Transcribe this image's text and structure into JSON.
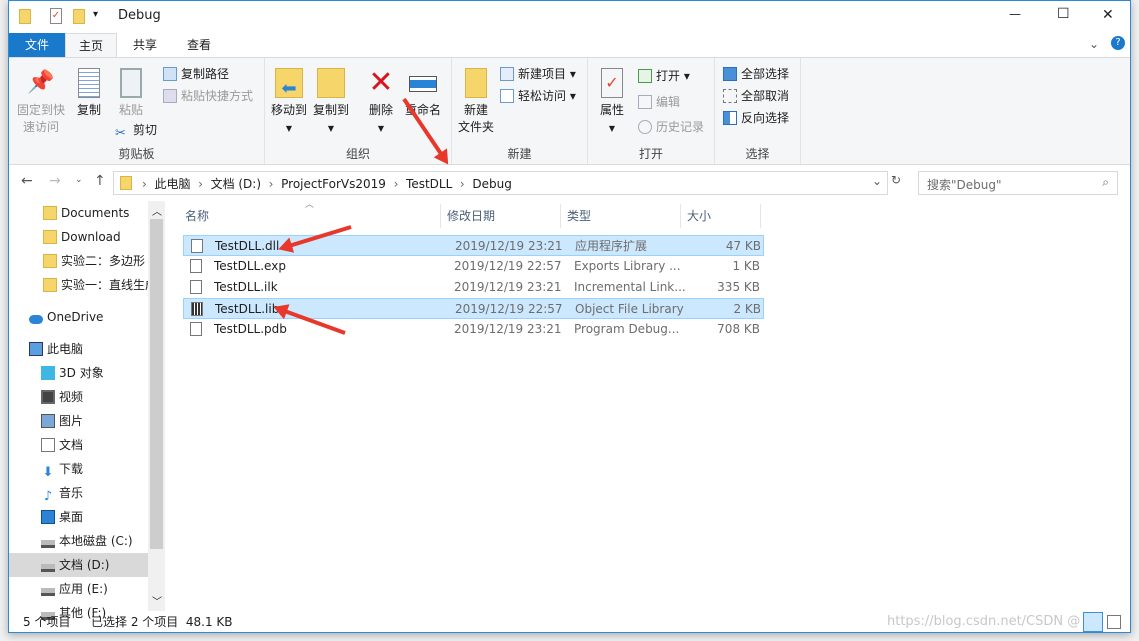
{
  "window": {
    "title": "Debug",
    "minimize": "—",
    "maximize": "☐",
    "close": "✕"
  },
  "tabs": [
    {
      "label": "文件"
    },
    {
      "label": "主页"
    },
    {
      "label": "共享"
    },
    {
      "label": "查看"
    }
  ],
  "help": "?",
  "ribbon": {
    "clipboard": {
      "label": "剪贴板",
      "pin": "固定到快\n速访问",
      "copy": "复制",
      "paste": "粘贴",
      "copy_path": "复制路径",
      "paste_shortcut": "粘贴快捷方式",
      "cut": "剪切"
    },
    "organize": {
      "label": "组织",
      "move_to": "移动到",
      "copy_to": "复制到",
      "delete": "删除",
      "rename": "重命名"
    },
    "new": {
      "label": "新建",
      "new_folder": "新建\n文件夹",
      "new_item": "新建项目",
      "easy_access": "轻松访问"
    },
    "open": {
      "label": "打开",
      "properties": "属性",
      "open": "打开",
      "edit": "编辑",
      "history": "历史记录"
    },
    "select": {
      "label": "选择",
      "select_all": "全部选择",
      "select_none": "全部取消",
      "invert": "反向选择"
    }
  },
  "address": {
    "crumbs": [
      "此电脑",
      "文档 (D:)",
      "ProjectForVs2019",
      "TestDLL",
      "Debug"
    ],
    "search_placeholder": "搜索\"Debug\""
  },
  "sidebar": {
    "items": [
      {
        "label": "Documents",
        "icon": "folder-icon"
      },
      {
        "label": "Download",
        "icon": "folder-icon"
      },
      {
        "label": "实验二：多边形",
        "icon": "folder-icon"
      },
      {
        "label": "实验一：直线生成",
        "icon": "folder-icon"
      },
      {
        "label": "OneDrive",
        "icon": "cloud-icon"
      },
      {
        "label": "此电脑",
        "icon": "computer-icon"
      },
      {
        "label": "3D 对象",
        "icon": "cube-icon"
      },
      {
        "label": "视频",
        "icon": "video-icon"
      },
      {
        "label": "图片",
        "icon": "picture-icon"
      },
      {
        "label": "文档",
        "icon": "document-icon"
      },
      {
        "label": "下载",
        "icon": "download-icon"
      },
      {
        "label": "音乐",
        "icon": "music-icon"
      },
      {
        "label": "桌面",
        "icon": "desktop-icon"
      },
      {
        "label": "本地磁盘 (C:)",
        "icon": "drive-icon"
      },
      {
        "label": "文档 (D:)",
        "icon": "drive-icon",
        "selected": true
      },
      {
        "label": "应用 (E:)",
        "icon": "drive-icon"
      },
      {
        "label": "其他 (F:)",
        "icon": "drive-icon"
      }
    ]
  },
  "columns": {
    "name": "名称",
    "date": "修改日期",
    "type": "类型",
    "size": "大小"
  },
  "files": [
    {
      "name": "TestDLL.dll",
      "date": "2019/12/19 23:21",
      "type": "应用程序扩展",
      "size": "47 KB",
      "selected": true,
      "icon": "dll-icon"
    },
    {
      "name": "TestDLL.exp",
      "date": "2019/12/19 22:57",
      "type": "Exports Library ...",
      "size": "1 KB",
      "selected": false,
      "icon": "gear-file-icon"
    },
    {
      "name": "TestDLL.ilk",
      "date": "2019/12/19 23:21",
      "type": "Incremental Link...",
      "size": "335 KB",
      "selected": false,
      "icon": "file-icon"
    },
    {
      "name": "TestDLL.lib",
      "date": "2019/12/19 22:57",
      "type": "Object File Library",
      "size": "2 KB",
      "selected": true,
      "icon": "library-icon"
    },
    {
      "name": "TestDLL.pdb",
      "date": "2019/12/19 23:21",
      "type": "Program Debug...",
      "size": "708 KB",
      "selected": false,
      "icon": "file-icon"
    }
  ],
  "status": {
    "count": "5 个项目",
    "selection": "已选择 2 个项目  48.1 KB"
  },
  "watermark": "https://blog.csdn.net/CSDN @",
  "colors": {
    "accent": "#1979ca",
    "selection": "#cce8ff",
    "arrow": "#e8372b"
  }
}
